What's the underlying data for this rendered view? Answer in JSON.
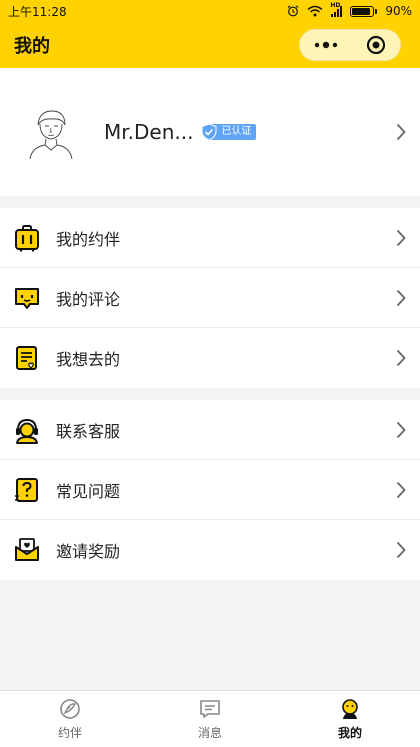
{
  "status_bar": {
    "time": "上午11:28",
    "battery": "90%",
    "hd": "HD"
  },
  "header": {
    "title": "我的"
  },
  "profile": {
    "name": "Mr.Den...",
    "badge": "已认证"
  },
  "menu_group_1": [
    {
      "label": "我的约伴",
      "icon": "suitcase-icon"
    },
    {
      "label": "我的评论",
      "icon": "comment-icon"
    },
    {
      "label": "我想去的",
      "icon": "wishlist-icon"
    }
  ],
  "menu_group_2": [
    {
      "label": "联系客服",
      "icon": "customer-service-icon"
    },
    {
      "label": "常见问题",
      "icon": "faq-icon"
    },
    {
      "label": "邀请奖励",
      "icon": "invite-icon"
    }
  ],
  "tabs": [
    {
      "label": "约伴",
      "icon": "companion-icon",
      "active": false
    },
    {
      "label": "消息",
      "icon": "message-icon",
      "active": false
    },
    {
      "label": "我的",
      "icon": "profile-icon",
      "active": true
    }
  ],
  "colors": {
    "brand_yellow": "#ffd200",
    "badge_blue": "#5fa4f5"
  }
}
